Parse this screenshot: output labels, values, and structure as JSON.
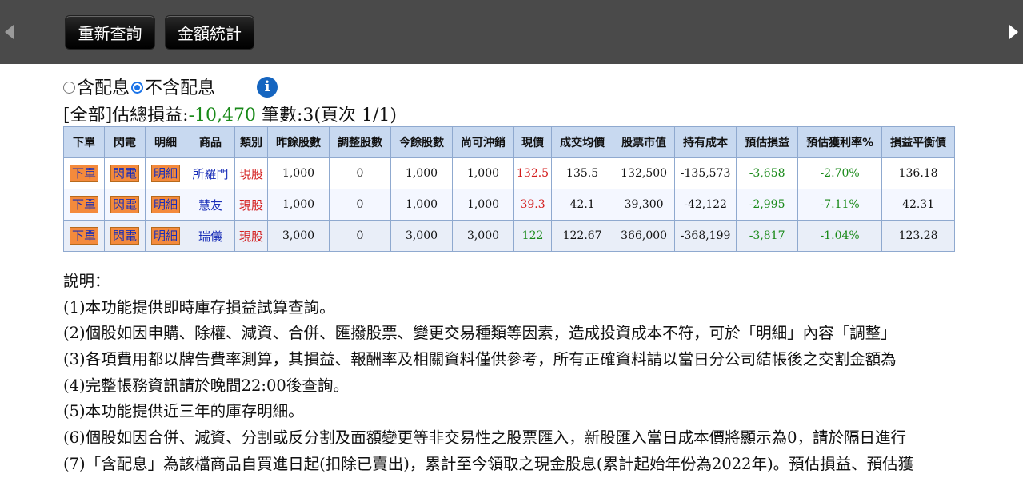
{
  "toolbar": {
    "requery_label": "重新查詢",
    "amount_stats_label": "金額統計"
  },
  "filter": {
    "option_with_dividend": "含配息",
    "option_without_dividend": "不含配息",
    "selected": "不含配息",
    "info_glyph": "i"
  },
  "summary": {
    "prefix": "[全部]估總損益:",
    "total_pnl": "-10,470",
    "count_text": " 筆數:3(頁次 1/1)"
  },
  "table": {
    "headers": [
      "下單",
      "閃電",
      "明細",
      "商品",
      "類別",
      "昨餘股數",
      "調整股數",
      "今餘股數",
      "尚可沖銷",
      "現價",
      "成交均價",
      "股票市值",
      "持有成本",
      "預估損益",
      "預估獲利率%",
      "損益平衡價"
    ],
    "action_labels": {
      "order": "下單",
      "flash": "閃電",
      "detail": "明細"
    },
    "rows": [
      {
        "name": "所羅門",
        "type": "現股",
        "prev_shares": "1,000",
        "adj_shares": "0",
        "today_shares": "1,000",
        "offsettable": "1,000",
        "price": "132.5",
        "price_color": "red",
        "avg_cost": "135.5",
        "market_value": "132,500",
        "holding_cost": "-135,573",
        "est_pnl": "-3,658",
        "est_return": "-2.70%",
        "breakeven": "136.18"
      },
      {
        "name": "慧友",
        "type": "現股",
        "prev_shares": "1,000",
        "adj_shares": "0",
        "today_shares": "1,000",
        "offsettable": "1,000",
        "price": "39.3",
        "price_color": "red",
        "avg_cost": "42.1",
        "market_value": "39,300",
        "holding_cost": "-42,122",
        "est_pnl": "-2,995",
        "est_return": "-7.11%",
        "breakeven": "42.31"
      },
      {
        "name": "瑞儀",
        "type": "現股",
        "prev_shares": "3,000",
        "adj_shares": "0",
        "today_shares": "3,000",
        "offsettable": "3,000",
        "price": "122",
        "price_color": "green",
        "avg_cost": "122.67",
        "market_value": "366,000",
        "holding_cost": "-368,199",
        "est_pnl": "-3,817",
        "est_return": "-1.04%",
        "breakeven": "123.28"
      }
    ]
  },
  "notes": {
    "title": "說明：",
    "lines": [
      "(1)本功能提供即時庫存損益試算查詢。",
      "(2)個股如因申購、除權、減資、合併、匯撥股票、變更交易種類等因素，造成投資成本不符，可於「明細」內容「調整」",
      "(3)各項費用都以牌告費率測算，其損益、報酬率及相關資料僅供參考，所有正確資料請以當日分公司結帳後之交割金額為",
      "(4)完整帳務資訊請於晚間22:00後查詢。",
      "(5)本功能提供近三年的庫存明細。",
      "(6)個股如因合併、減資、分割或反分割及面額變更等非交易性之股票匯入，新股匯入當日成本價將顯示為0，請於隔日進行",
      "(7)「含配息」為該檔商品自買進日起(扣除已賣出)，累計至今領取之現金股息(累計起始年份為2022年)。預估損益、預估獲"
    ]
  },
  "colors": {
    "toolbar_bg": "#4a4a4a",
    "header_bg": "#c8d9f0",
    "action_bg": "#f48a3c",
    "negative_green": "#1a8a1a",
    "price_red": "#d31b1b",
    "info_blue": "#1565c0"
  }
}
